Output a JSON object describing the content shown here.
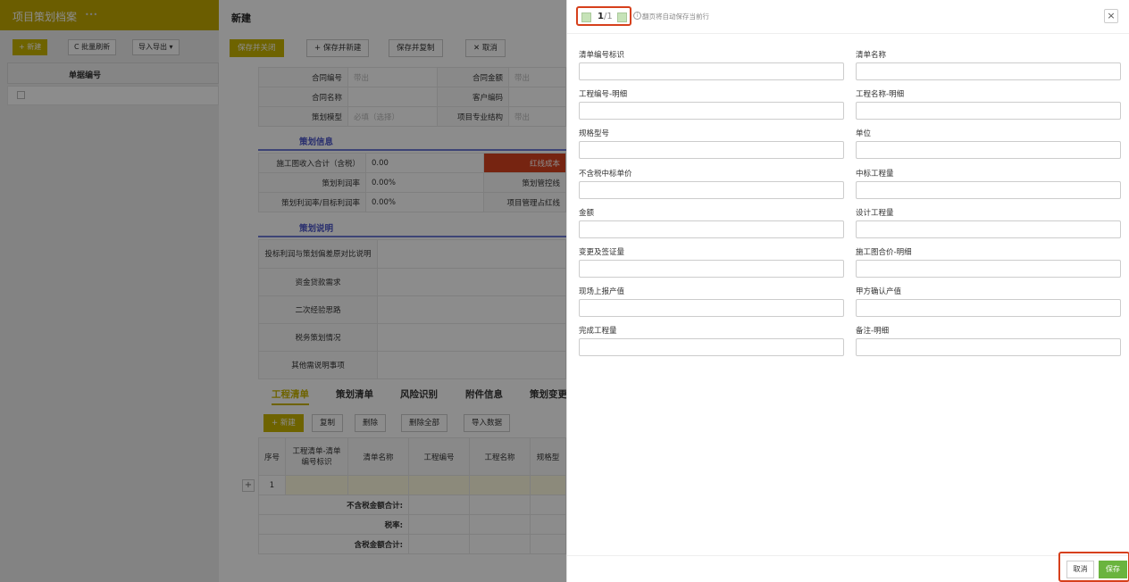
{
  "app": {
    "title": "项目策划档案",
    "tag": "•••",
    "toolbar": {
      "new": "+ 新建",
      "refresh": "C 批量刷新",
      "import_export": "导入导出 ▾"
    },
    "grid_header": "单据编号"
  },
  "form": {
    "title": "新建",
    "toolbar": {
      "save_close": "保存并关闭",
      "save_new": "+ 保存并新建",
      "save_copy": "保存并复制",
      "cancel": "✕ 取消"
    },
    "rows": [
      {
        "l1": "合同编号",
        "v1": "带出",
        "l2": "合同金额",
        "v2": "带出"
      },
      {
        "l1": "合同名称",
        "v1": "",
        "l2": "客户编码",
        "v2": ""
      },
      {
        "l1": "策划模型",
        "v1": "必填（选择）",
        "l2": "项目专业结构",
        "v2": "带出"
      }
    ],
    "section_plan": "策划信息",
    "plan_rows": [
      {
        "l": "施工图收入合计（含税）",
        "v": "0.00",
        "r": "红线成本"
      },
      {
        "l": "策划利润率",
        "v": "0.00%",
        "r": "策划管控线"
      },
      {
        "l": "策划利润率/目标利润率",
        "v": "0.00%",
        "r": "项目管理占红线"
      }
    ],
    "section_desc": "策划说明",
    "desc_rows": [
      "投标利润与策划偏差原对比说明",
      "资金贷款需求",
      "二次经验思路",
      "税务策划情况",
      "其他需说明事项"
    ],
    "tabs": [
      "工程清单",
      "策划清单",
      "风险识别",
      "附件信息",
      "策划变更"
    ],
    "sub_toolbar": {
      "new": "+ 新建",
      "copy": "复制",
      "delete": "删除",
      "delete_all": "删除全部",
      "import": "导入数据"
    },
    "grid_cols": [
      "序号",
      "工程清单-清单编号标识",
      "清单名称",
      "工程编号",
      "工程名称",
      "规格型"
    ],
    "grid_row_no": "1",
    "totals": [
      "不含税金额合计:",
      "税率:",
      "含税金额合计:"
    ]
  },
  "drawer": {
    "page_current": "1",
    "page_total": "/1",
    "hint": "翻页将自动保存当前行",
    "fields": [
      {
        "label": "清单编号标识",
        "value": ""
      },
      {
        "label": "清单名称",
        "value": ""
      },
      {
        "label": "工程编号-明细",
        "value": ""
      },
      {
        "label": "工程名称-明细",
        "value": ""
      },
      {
        "label": "规格型号",
        "value": ""
      },
      {
        "label": "单位",
        "value": ""
      },
      {
        "label": "不含税中标单价",
        "value": ""
      },
      {
        "label": "中标工程量",
        "value": ""
      },
      {
        "label": "金额",
        "value": ""
      },
      {
        "label": "设计工程量",
        "value": ""
      },
      {
        "label": "变更及签证量",
        "value": ""
      },
      {
        "label": "施工图合价-明细",
        "value": ""
      },
      {
        "label": "现场上报产值",
        "value": ""
      },
      {
        "label": "甲方确认产值",
        "value": ""
      },
      {
        "label": "完成工程量",
        "value": ""
      },
      {
        "label": "备注-明细",
        "value": ""
      }
    ],
    "cancel": "取消",
    "save": "保存"
  },
  "colors": {
    "accent": "#c8b400",
    "danger_box": "#d6401c",
    "save": "#6ab43e",
    "section": "#4a54c8"
  }
}
